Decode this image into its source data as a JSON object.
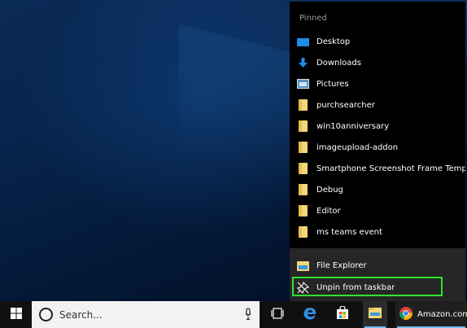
{
  "jumplist": {
    "section_header": "Pinned",
    "pinned": [
      {
        "label": "Desktop",
        "icon": "desktop-icon"
      },
      {
        "label": "Downloads",
        "icon": "downloads-icon"
      },
      {
        "label": "Pictures",
        "icon": "pictures-icon"
      },
      {
        "label": "purchsearcher",
        "icon": "folder-icon"
      },
      {
        "label": "win10anniversary",
        "icon": "folder-icon"
      },
      {
        "label": "imageupload-addon",
        "icon": "folder-icon"
      },
      {
        "label": "Smartphone Screenshot Frame Templa...",
        "icon": "folder-icon"
      },
      {
        "label": "Debug",
        "icon": "folder-icon"
      },
      {
        "label": "Editor",
        "icon": "folder-icon"
      },
      {
        "label": "ms teams event",
        "icon": "folder-icon"
      }
    ],
    "footer": {
      "app_label": "File Explorer",
      "unpin_label": "Unpin from taskbar"
    }
  },
  "taskbar": {
    "search_placeholder": "Search...",
    "chrome_label": "Amazon.com:"
  },
  "colors": {
    "highlight_box": "#2de62d",
    "folder": "#f4d679",
    "taskbar": "#101010",
    "jumplist_bg": "#000000",
    "footer_bg": "#262626",
    "accent": "#1e8fe6"
  }
}
